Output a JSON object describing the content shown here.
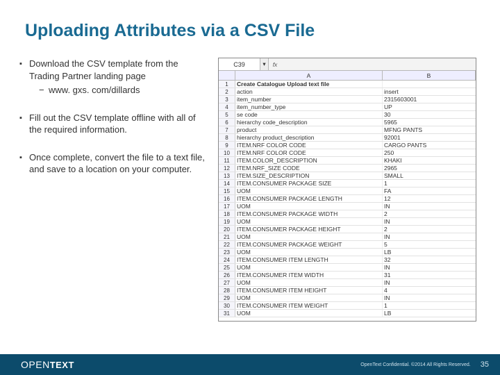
{
  "title": "Uploading Attributes via a CSV File",
  "bullets": [
    {
      "text": "Download the CSV template from the Trading Partner landing page",
      "sub": [
        "www. gxs. com/dillards"
      ]
    },
    {
      "text": "Fill out the CSV template offline with all of the required information.",
      "sub": []
    },
    {
      "text": "Once complete, convert the file to a text file, and save to a location on your computer.",
      "sub": []
    }
  ],
  "spreadsheet": {
    "name_box": "C39",
    "fx_label": "fx",
    "columns": [
      "A",
      "B"
    ],
    "title_row": [
      "Create Catalogue Upload text file",
      ""
    ],
    "rows": [
      [
        "action",
        "insert"
      ],
      [
        "item_number",
        "2315603001"
      ],
      [
        "item_number_type",
        "UP"
      ],
      [
        "se code",
        "30"
      ],
      [
        "hierarchy code_description",
        "5965"
      ],
      [
        "product",
        "MFNG PANTS"
      ],
      [
        "hierarchy product_description",
        "92001"
      ],
      [
        "ITEM.NRF COLOR CODE",
        "CARGO PANTS"
      ],
      [
        "ITEM.NRF COLOR CODE",
        "250"
      ],
      [
        "ITEM.COLOR_DESCRIPTION",
        "KHAKI"
      ],
      [
        "ITEM.NRF_SIZE CODE",
        "2965"
      ],
      [
        "ITEM.SIZE_DESCRIPTION",
        "SMALL"
      ],
      [
        "ITEM.CONSUMER PACKAGE SIZE",
        "1"
      ],
      [
        "    UOM",
        "FA"
      ],
      [
        "ITEM.CONSUMER PACKAGE LENGTH",
        "12"
      ],
      [
        "    UOM",
        "IN"
      ],
      [
        "ITEM.CONSUMER PACKAGE WIDTH",
        "2"
      ],
      [
        "    UOM",
        "IN"
      ],
      [
        "ITEM.CONSUMER PACKAGE HEIGHT",
        "2"
      ],
      [
        "    UOM",
        "IN"
      ],
      [
        "ITEM.CONSUMER PACKAGE WEIGHT",
        "5"
      ],
      [
        "    UOM",
        "LB"
      ],
      [
        "ITEM.CONSUMER ITEM LENGTH",
        "32"
      ],
      [
        "    UOM",
        "IN"
      ],
      [
        "ITEM.CONSUMER ITEM WIDTH",
        "31"
      ],
      [
        "    UOM",
        "IN"
      ],
      [
        "ITEM.CONSUMER ITEM HEIGHT",
        "4"
      ],
      [
        "    UOM",
        "IN"
      ],
      [
        "ITEM.CONSUMER ITEM WEIGHT",
        "1"
      ],
      [
        "    UOM",
        "LB"
      ]
    ]
  },
  "footer": {
    "brand_open": "OPEN",
    "brand_text": "TEXT",
    "confidential": "OpenText Confidential. ©2014 All Rights Reserved.",
    "page": "35"
  }
}
